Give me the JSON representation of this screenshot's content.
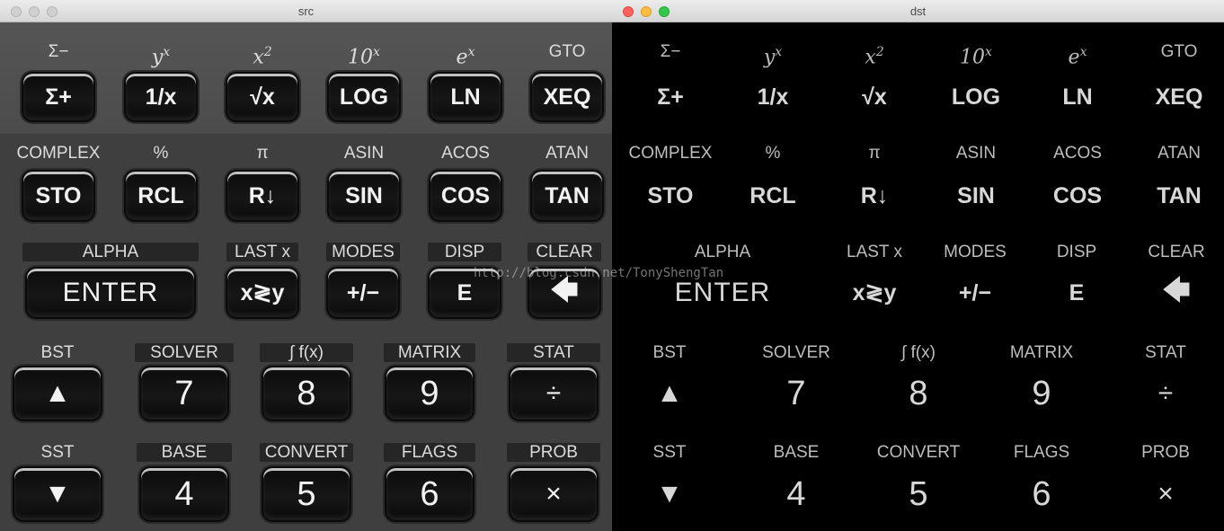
{
  "windows": {
    "src": {
      "title": "src"
    },
    "dst": {
      "title": "dst"
    }
  },
  "calculator": {
    "row1": [
      {
        "label": "Σ−",
        "key": "Σ+"
      },
      {
        "label": "y",
        "label_sup": "x",
        "key": "1/x"
      },
      {
        "label": "x",
        "label_sup": "2",
        "key": "√x"
      },
      {
        "label": "10",
        "label_sup": "x",
        "key": "LOG"
      },
      {
        "label": "e",
        "label_sup": "x",
        "key": "LN"
      },
      {
        "label": "GTO",
        "key": "XEQ"
      }
    ],
    "row2": [
      {
        "label": "COMPLEX",
        "key": "STO"
      },
      {
        "label": "%",
        "key": "RCL"
      },
      {
        "label": "π",
        "key": "R↓"
      },
      {
        "label": "ASIN",
        "key": "SIN"
      },
      {
        "label": "ACOS",
        "key": "COS"
      },
      {
        "label": "ATAN",
        "key": "TAN"
      }
    ],
    "row3": [
      {
        "label": "ALPHA",
        "key": "ENTER"
      },
      {
        "label": "LAST x",
        "key": "x≷y"
      },
      {
        "label": "MODES",
        "key": "+/−"
      },
      {
        "label": "DISP",
        "key": "E"
      },
      {
        "label": "CLEAR",
        "key": "🡄"
      }
    ],
    "row4": [
      {
        "label": "BST",
        "key": "▲"
      },
      {
        "label": "SOLVER",
        "key": "7"
      },
      {
        "label": "∫ f(x)",
        "key": "8"
      },
      {
        "label": "MATRIX",
        "key": "9"
      },
      {
        "label": "STAT",
        "key": "÷"
      }
    ],
    "row5": [
      {
        "label": "SST",
        "key": "▼"
      },
      {
        "label": "BASE",
        "key": "4"
      },
      {
        "label": "CONVERT",
        "key": "5"
      },
      {
        "label": "FLAGS",
        "key": "6"
      },
      {
        "label": "PROB",
        "key": "×"
      }
    ]
  },
  "watermark": "http://blog.csdn.net/TonyShengTan"
}
